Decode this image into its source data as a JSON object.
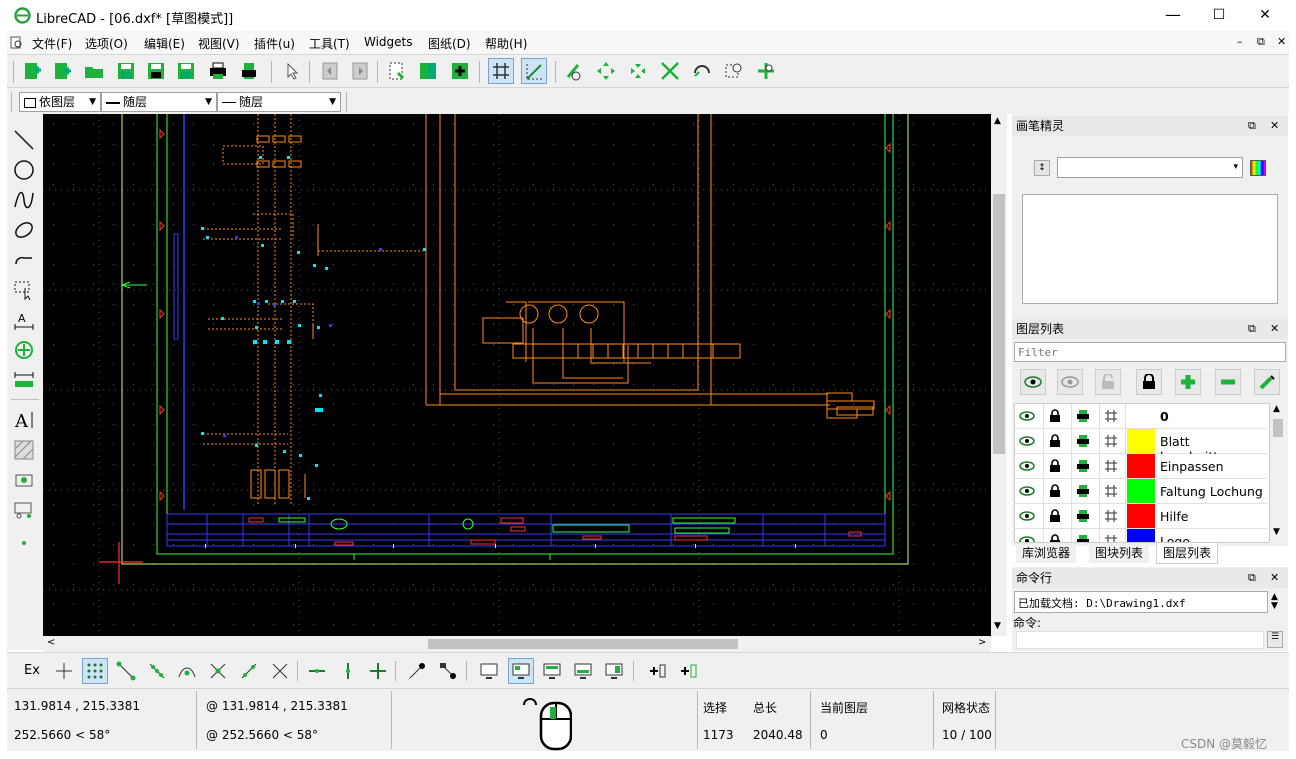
{
  "window": {
    "title": "LibreCAD - [06.dxf* [草图模式]]",
    "minimize": "—",
    "maximize": "☐",
    "close": "✕"
  },
  "menu": {
    "items": [
      "文件(F)",
      "选项(O)",
      "编辑(E)",
      "视图(V)",
      "插件(u)",
      "工具(T)",
      "Widgets",
      "图纸(D)",
      "帮助(H)"
    ],
    "right_controls": [
      "–",
      "⧉",
      "✕"
    ]
  },
  "pen_toolbar": {
    "color": "依图层",
    "width": "随层",
    "linetype": "随层"
  },
  "pen_wizard": {
    "title": "画笔精灵",
    "sort_label": "↕"
  },
  "layer_list": {
    "title": "图层列表",
    "filter_placeholder": "Filter",
    "layers": [
      {
        "name": "0",
        "color": "#ffffff"
      },
      {
        "name": "Blatt beschnitten",
        "color": "#ffff00"
      },
      {
        "name": "Einpassen",
        "color": "#ff0000"
      },
      {
        "name": "Faltung Lochung",
        "color": "#00ff00"
      },
      {
        "name": "Hilfe",
        "color": "#ff0000"
      },
      {
        "name": "Logo",
        "color": "#0000ff"
      }
    ]
  },
  "tabs": [
    "库浏览器",
    "图块列表",
    "图层列表"
  ],
  "command": {
    "title": "命令行",
    "history": "已加载文档: D:\\Drawing1.dxf",
    "prompt_label": "命令:"
  },
  "snap_toolbar": {
    "ex_label": "Ex"
  },
  "status": {
    "abs_coord": "131.9814 , 215.3381",
    "abs_polar": "252.5660 < 58°",
    "rel_coord": "@  131.9814 , 215.3381",
    "rel_polar": "@  252.5660 < 58°",
    "selection_label": "选择",
    "selection_value": "1173",
    "total_label": "总长",
    "total_value": "2040.48",
    "layer_label": "当前图层",
    "layer_value": "0",
    "grid_label": "网格状态",
    "grid_value": "10 / 100"
  },
  "watermark": "CSDN @莫毅忆",
  "colors": {
    "canvas_bg": "#000000",
    "drawing_orange": "#ff8c1a",
    "drawing_green": "#33ff33",
    "drawing_yellow_green": "#ccff66",
    "drawing_blue": "#2b3cff",
    "drawing_cyan": "#00e5ff",
    "drawing_red": "#ff3030"
  }
}
